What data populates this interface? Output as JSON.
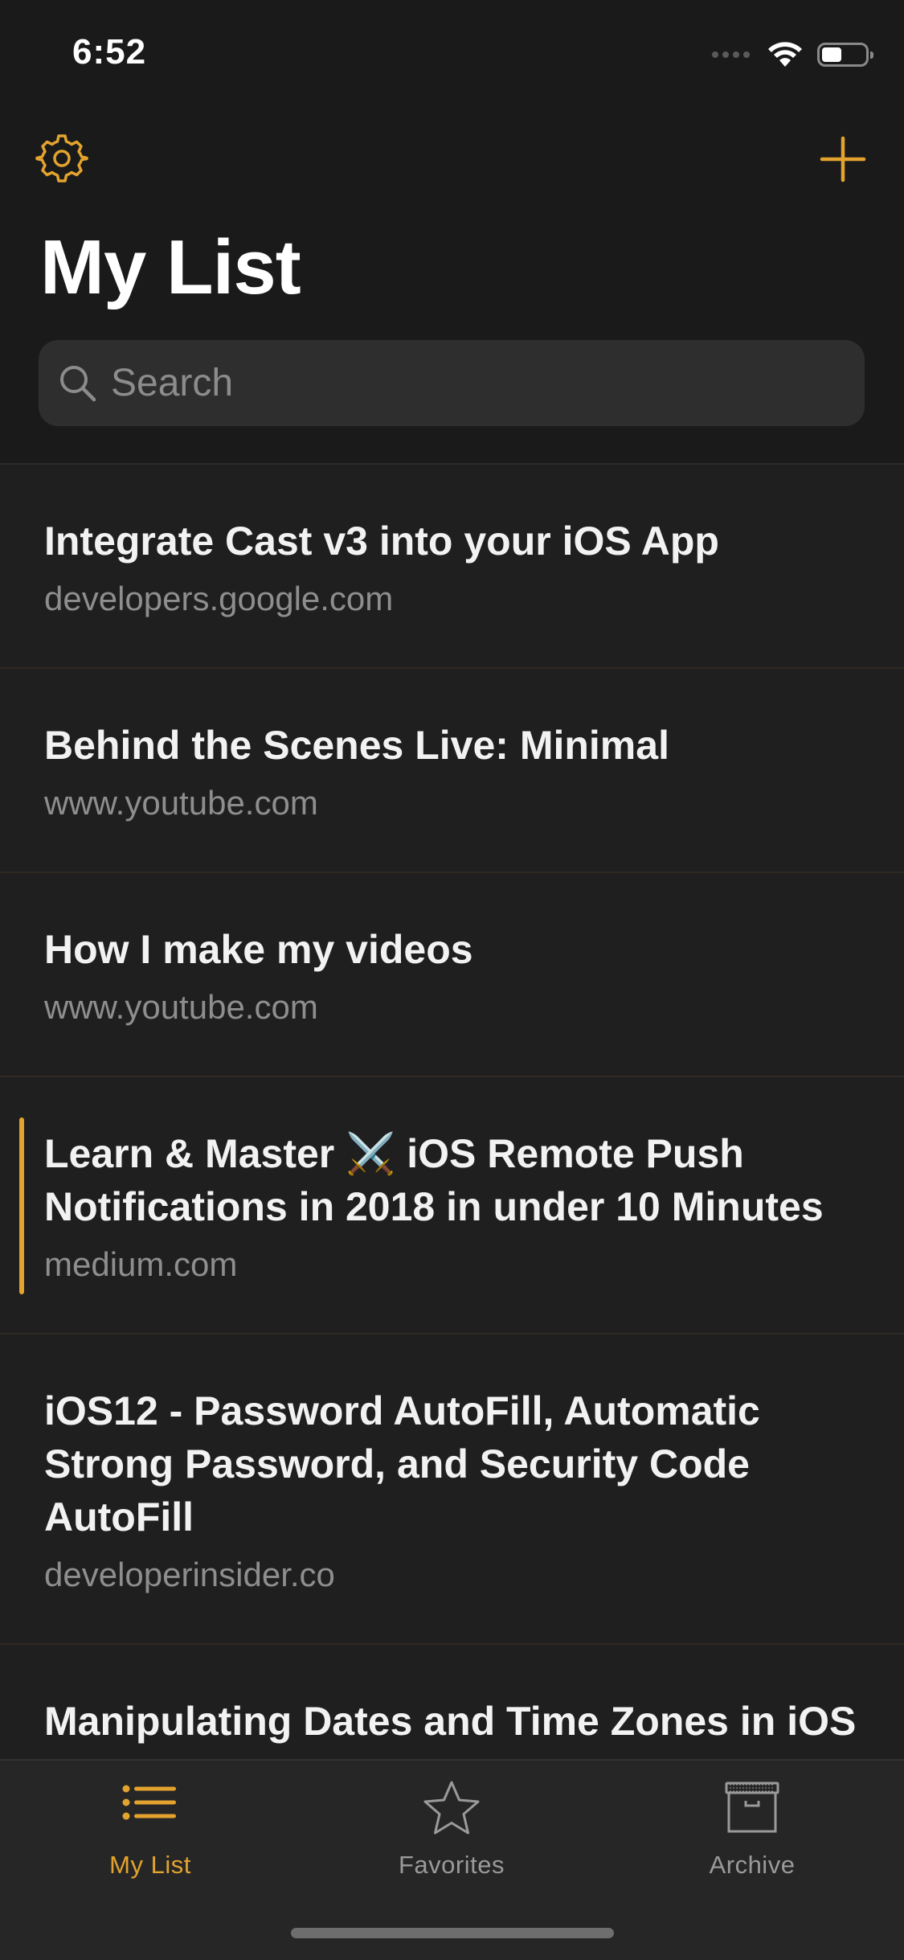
{
  "status_bar": {
    "time": "6:52"
  },
  "header": {
    "title": "My List",
    "settings_icon": "gear-icon",
    "add_icon": "plus-icon"
  },
  "search": {
    "placeholder": "Search",
    "value": ""
  },
  "items": [
    {
      "title": "Integrate Cast v3 into your iOS App",
      "domain": "developers.google.com"
    },
    {
      "title": "Behind the Scenes Live: Minimal",
      "domain": "www.youtube.com"
    },
    {
      "title": "How I make my videos",
      "domain": "www.youtube.com"
    },
    {
      "title": "Learn & Master ⚔️ iOS Remote Push Notifications in 2018 in under 10 Minutes",
      "domain": "medium.com",
      "marked": true
    },
    {
      "title": "iOS12 - Password AutoFill, Automatic Strong Password, and Security Code AutoFill",
      "domain": "developerinsider.co"
    },
    {
      "title": "Manipulating Dates and Time Zones in iOS",
      "domain": ""
    }
  ],
  "tabs": [
    {
      "label": "My List",
      "icon": "list-icon",
      "active": true
    },
    {
      "label": "Favorites",
      "icon": "star-icon",
      "active": false
    },
    {
      "label": "Archive",
      "icon": "archive-box-icon",
      "active": false
    }
  ],
  "colors": {
    "accent": "#e3a32e",
    "background": "#1f1f1f",
    "tab_inactive": "#9a9a9a"
  }
}
